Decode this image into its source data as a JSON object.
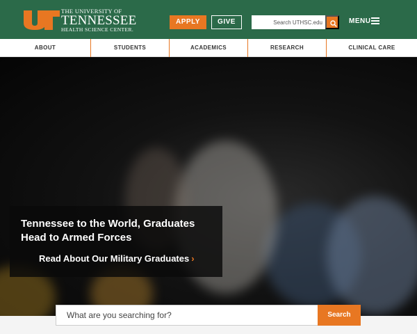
{
  "header": {
    "logo_line1": "THE UNIVERSITY OF",
    "logo_line2": "TENNESSEE",
    "logo_line3": "HEALTH SCIENCE CENTER.",
    "apply_label": "APPLY",
    "give_label": "GIVE",
    "search_placeholder": "Search UTHSC.edu",
    "menu_label": "MENU"
  },
  "nav": {
    "items": [
      {
        "label": "ABOUT"
      },
      {
        "label": "STUDENTS"
      },
      {
        "label": "ACADEMICS"
      },
      {
        "label": "RESEARCH"
      },
      {
        "label": "CLINICAL CARE"
      }
    ]
  },
  "hero": {
    "title": "Tennessee to the World, Graduates Head to Armed Forces",
    "link_label": "Read About Our Military Graduates",
    "link_arrow": "›"
  },
  "search": {
    "placeholder": "What are you searching for?",
    "button_label": "Search"
  },
  "colors": {
    "brand_green": "#2b6a49",
    "accent_orange": "#e87722"
  },
  "icons": [
    "ut-logo-icon",
    "search-icon",
    "hamburger-menu-icon",
    "chevron-right-icon"
  ]
}
